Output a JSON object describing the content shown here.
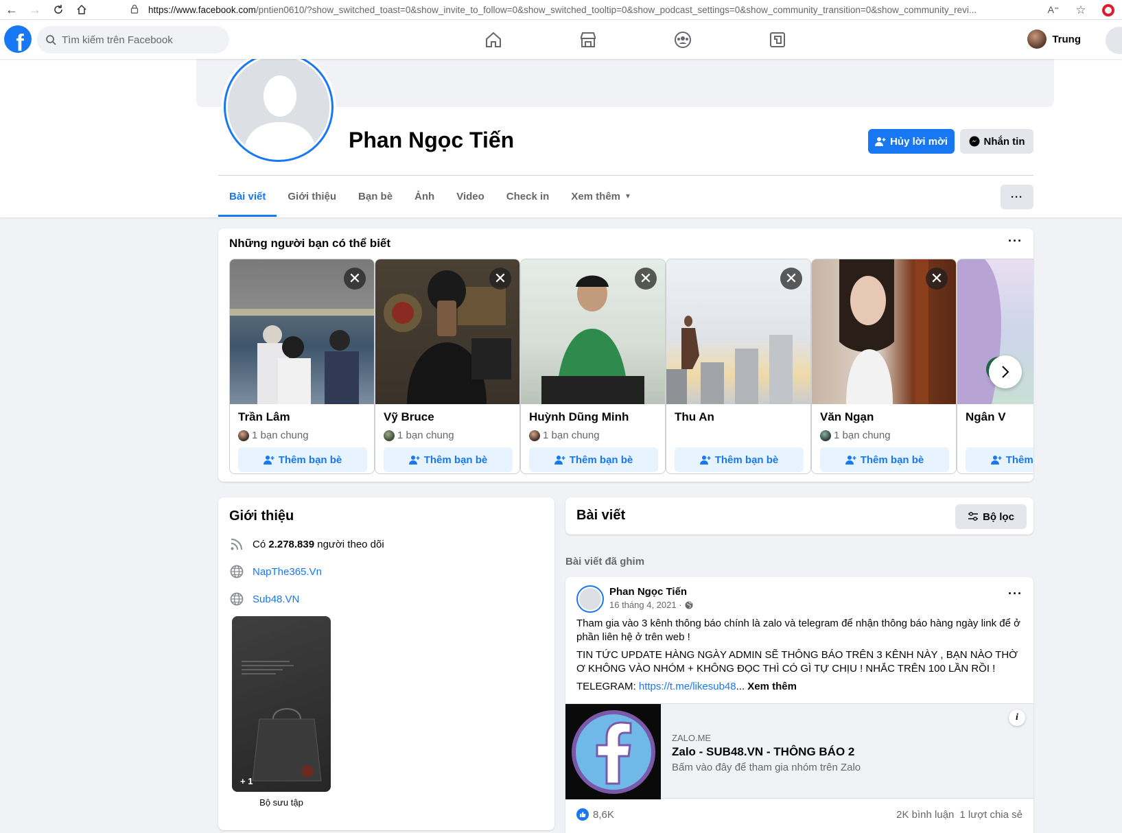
{
  "browser": {
    "url_host": "https://www.facebook.com",
    "url_rest": "/pntien0610/?show_switched_toast=0&show_invite_to_follow=0&show_switched_tooltip=0&show_podcast_settings=0&show_community_transition=0&show_community_revi..."
  },
  "nav": {
    "search_placeholder": "Tìm kiếm trên Facebook",
    "user_name": "Trung"
  },
  "profile": {
    "name": "Phan Ngọc Tiến",
    "primary_button": "Hủy lời mời",
    "message_button": "Nhắn tin",
    "tabs": [
      "Bài viết",
      "Giới thiệu",
      "Bạn bè",
      "Ảnh",
      "Video",
      "Check in",
      "Xem thêm"
    ],
    "more": "···"
  },
  "pymk": {
    "title": "Những người bạn có thể biết",
    "add_label": "Thêm bạn bè",
    "people": [
      {
        "name": "Trần Lâm",
        "mutual": "1 bạn chung"
      },
      {
        "name": "Vỹ Bruce",
        "mutual": "1 bạn chung"
      },
      {
        "name": "Huỳnh Dũng Minh",
        "mutual": "1 bạn chung"
      },
      {
        "name": "Thu An",
        "mutual": ""
      },
      {
        "name": "Văn Ngạn",
        "mutual": "1 bạn chung"
      },
      {
        "name": "Ngân V",
        "mutual": ""
      }
    ]
  },
  "intro": {
    "title": "Giới thiệu",
    "followers_prefix": "Có ",
    "followers_count": "2.278.839",
    "followers_suffix": " người theo dõi",
    "link1": "NapThe365.Vn",
    "link2": "Sub48.VN",
    "collection_more": "+ 1",
    "collection_label": "Bộ sưu tập"
  },
  "posts": {
    "title": "Bài viết",
    "filter": "Bộ lọc",
    "pinned_label": "Bài viết đã ghim",
    "pinned": {
      "author": "Phan Ngọc Tiến",
      "date": "16 tháng 4, 2021 ·",
      "p1": "Tham gia vào 3 kênh thông báo chính là zalo và telegram để nhận thông báo hàng ngày link để ở phần liên hệ ở trên web !",
      "p2": "TIN TỨC UPDATE HÀNG NGÀY ADMIN SẼ THÔNG BÁO TRÊN 3 KÊNH NÀY , BẠN NÀO THỜ Ơ KHÔNG VÀO NHÓM + KHÔNG ĐỌC THÌ CÓ GÌ TỰ CHỊU ! NHẮC TRÊN 100 LẦN RỒI !",
      "p3_prefix": "TELEGRAM: ",
      "p3_link": "https://t.me/likesub48",
      "p3_suffix": "... ",
      "see_more": "Xem thêm",
      "preview_domain": "ZALO.ME",
      "preview_title": "Zalo - SUB48.VN - THÔNG BÁO 2",
      "preview_desc": "Bấm vào đây để tham gia nhóm trên Zalo",
      "likes": "8,6K",
      "comments": "2K bình luận",
      "shares": "1 lượt chia sẻ"
    }
  },
  "colors": {
    "brand": "#1877f2",
    "background": "#f0f2f5",
    "secondary_text": "#65676b"
  }
}
